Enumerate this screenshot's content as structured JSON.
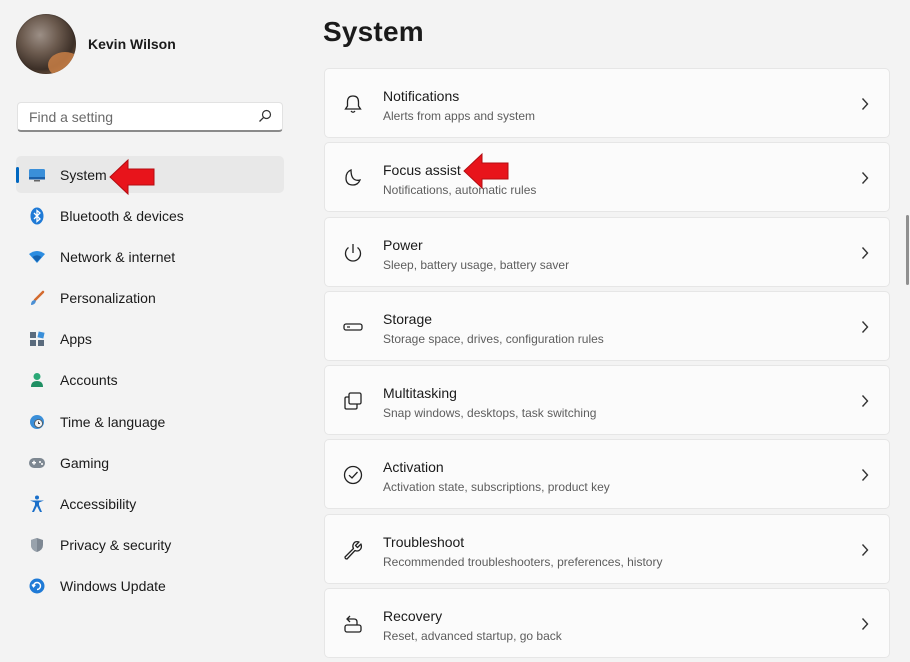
{
  "user": {
    "name": "Kevin Wilson"
  },
  "search": {
    "placeholder": "Find a setting",
    "icon": "search-icon"
  },
  "sidebar": {
    "items": [
      {
        "label": "System",
        "icon": "monitor-icon",
        "active": true
      },
      {
        "label": "Bluetooth & devices",
        "icon": "bluetooth-icon"
      },
      {
        "label": "Network & internet",
        "icon": "wifi-icon"
      },
      {
        "label": "Personalization",
        "icon": "brush-icon"
      },
      {
        "label": "Apps",
        "icon": "apps-icon"
      },
      {
        "label": "Accounts",
        "icon": "person-icon"
      },
      {
        "label": "Time & language",
        "icon": "clock-globe-icon"
      },
      {
        "label": "Gaming",
        "icon": "gamepad-icon"
      },
      {
        "label": "Accessibility",
        "icon": "accessibility-icon"
      },
      {
        "label": "Privacy & security",
        "icon": "shield-icon"
      },
      {
        "label": "Windows Update",
        "icon": "update-icon"
      }
    ]
  },
  "main": {
    "title": "System",
    "cards": [
      {
        "title": "Notifications",
        "desc": "Alerts from apps and system",
        "icon": "bell-icon"
      },
      {
        "title": "Focus assist",
        "desc": "Notifications, automatic rules",
        "icon": "moon-icon"
      },
      {
        "title": "Power",
        "desc": "Sleep, battery usage, battery saver",
        "icon": "power-icon"
      },
      {
        "title": "Storage",
        "desc": "Storage space, drives, configuration rules",
        "icon": "drive-icon"
      },
      {
        "title": "Multitasking",
        "desc": "Snap windows, desktops, task switching",
        "icon": "multitask-icon"
      },
      {
        "title": "Activation",
        "desc": "Activation state, subscriptions, product key",
        "icon": "check-circle-icon"
      },
      {
        "title": "Troubleshoot",
        "desc": "Recommended troubleshooters, preferences, history",
        "icon": "wrench-icon"
      },
      {
        "title": "Recovery",
        "desc": "Reset, advanced startup, go back",
        "icon": "recovery-icon"
      }
    ]
  },
  "colors": {
    "accent": "#0067c0",
    "annotation_arrow": "#e8141b",
    "background": "#f3f3f3"
  }
}
